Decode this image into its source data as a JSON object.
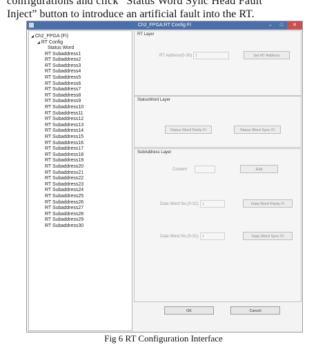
{
  "paper": {
    "line1": "configurations and click “Status Word Sync Head Fault",
    "line2": "Inject” button to introduce an artificial fault into the RT.",
    "caption": "Fig 6 RT Configuration Interface"
  },
  "window": {
    "title": "Ch2_FPGA:RT Config FI",
    "buttons": [
      "–",
      "□",
      "✕"
    ]
  },
  "tree": {
    "root": "Ch2_FPGA (FI)",
    "group": "RT Config",
    "items": [
      "Status Word",
      "RT Subaddress1",
      "RT Subaddress2",
      "RT Subaddress3",
      "RT Subaddress4",
      "RT Subaddress5",
      "RT Subaddress6",
      "RT Subaddress7",
      "RT Subaddress8",
      "RT Subaddress9",
      "RT Subaddress10",
      "RT Subaddress11",
      "RT Subaddress12",
      "RT Subaddress13",
      "RT Subaddress14",
      "RT Subaddress15",
      "RT Subaddress16",
      "RT Subaddress17",
      "RT Subaddress18",
      "RT Subaddress19",
      "RT Subaddress20",
      "RT Subaddress21",
      "RT Subaddress22",
      "RT Subaddress23",
      "RT Subaddress24",
      "RT Subaddress25",
      "RT Subaddress26",
      "RT Subaddress27",
      "RT Subaddress28",
      "RT Subaddress29",
      "RT Subaddress30"
    ]
  },
  "rt_layer": {
    "title": "RT Layer",
    "address_label": "RT Address(0-30)",
    "address_value": "1",
    "set_button": "Set RT Address"
  },
  "statusword_layer": {
    "title": "StatusWord Layer",
    "parity_button": "Status Word Parity FI",
    "sync_button": "Status Word Sync FI"
  },
  "subaddress_layer": {
    "title": "SubAddress Layer",
    "content_label": "Content",
    "edit_button": "Edit",
    "dw_parity_label": "Data Word No.(0-31)",
    "dw_parity_value": "1",
    "dw_parity_button": "Data Word Parity FI",
    "dw_sync_label": "Data Word No.(0-31)",
    "dw_sync_value": "1",
    "dw_sync_button": "Data Word Sync FI"
  },
  "footer": {
    "ok": "OK",
    "cancel": "Cancel"
  }
}
